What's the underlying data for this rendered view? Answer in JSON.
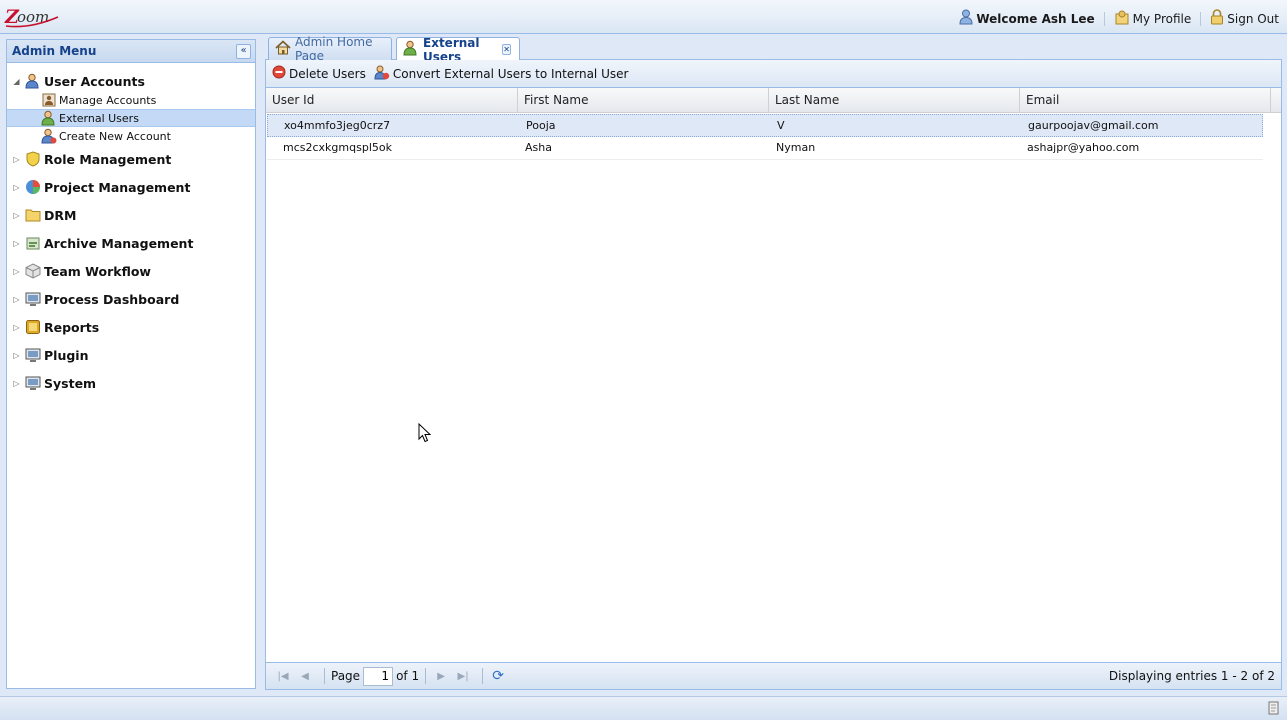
{
  "header": {
    "logo_text": "Zoom",
    "welcome": "Welcome Ash Lee",
    "my_profile": "My Profile",
    "sign_out": "Sign Out"
  },
  "menu": {
    "title": "Admin Menu",
    "collapse_glyph": "«",
    "groups": [
      {
        "label": "User Accounts",
        "expanded": true,
        "icon": "user-accounts-icon",
        "children": [
          {
            "label": "Manage Accounts",
            "icon": "manage-accounts-icon",
            "selected": false
          },
          {
            "label": "External Users",
            "icon": "external-users-icon",
            "selected": true
          },
          {
            "label": "Create New Account",
            "icon": "create-account-icon",
            "selected": false
          }
        ]
      },
      {
        "label": "Role Management",
        "icon": "shield-icon"
      },
      {
        "label": "Project Management",
        "icon": "pie-chart-icon"
      },
      {
        "label": "DRM",
        "icon": "folder-icon"
      },
      {
        "label": "Archive Management",
        "icon": "archive-icon"
      },
      {
        "label": "Team Workflow",
        "icon": "workflow-icon"
      },
      {
        "label": "Process Dashboard",
        "icon": "monitor-icon"
      },
      {
        "label": "Reports",
        "icon": "reports-icon"
      },
      {
        "label": "Plugin",
        "icon": "monitor-icon"
      },
      {
        "label": "System",
        "icon": "monitor-icon"
      }
    ]
  },
  "tabs": [
    {
      "label": "Admin Home Page",
      "icon": "home-icon",
      "active": false
    },
    {
      "label": "External Users",
      "icon": "external-users-icon",
      "active": true,
      "closable": true
    }
  ],
  "toolbar": {
    "delete_label": "Delete Users",
    "convert_label": "Convert External Users to Internal User"
  },
  "grid": {
    "columns": [
      "User Id",
      "First Name",
      "Last Name",
      "Email"
    ],
    "rows": [
      {
        "user_id": "xo4mmfo3jeg0crz7",
        "first_name": "Pooja",
        "last_name": "V",
        "email": "gaurpoojav@gmail.com",
        "selected": true
      },
      {
        "user_id": "mcs2cxkgmqspl5ok",
        "first_name": "Asha",
        "last_name": "Nyman",
        "email": "ashajpr@yahoo.com",
        "selected": false
      }
    ]
  },
  "pager": {
    "page_label": "Page",
    "page_value": "1",
    "of_label": "of 1",
    "status": "Displaying entries 1 - 2 of 2"
  },
  "colors": {
    "accent": "#15428b",
    "border": "#99bbe8",
    "selected_row": "#dfe8f6"
  }
}
